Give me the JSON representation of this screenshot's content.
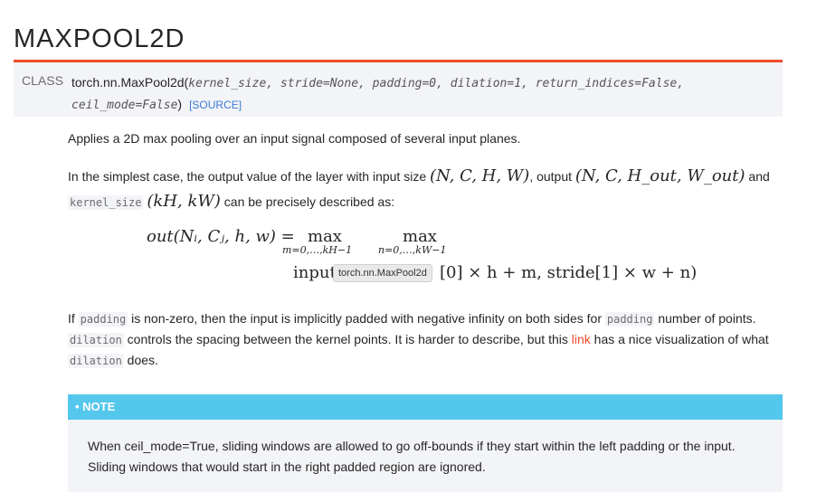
{
  "title": "MAXPOOL2D",
  "class_sig": {
    "label": "CLASS",
    "name": "torch.nn.MaxPool2d(",
    "params1": "kernel_size, stride=None, padding=0, dilation=1, return_indices=False,",
    "params2": "ceil_mode=False",
    ")": ")",
    "source": "[SOURCE]"
  },
  "desc": {
    "p1": "Applies a 2D max pooling over an input signal composed of several input planes.",
    "p2a": "In the simplest case, the output value of the layer with input size ",
    "p2m1": "(N, C, H, W)",
    "p2b": ", output ",
    "p2m2": "(N, C, H_out, W_out)",
    "p2c": " and",
    "p2code": "kernel_size",
    "p2m3": "(kH, kW)",
    "p2d": " can be precisely described as:",
    "eq_lhs": "out(Nᵢ, Cⱼ, h, w) =",
    "eq_max1": "max",
    "eq_sub1": "m=0,…,kH−1",
    "eq_max2": "max",
    "eq_sub2": "n=0,…,kW−1",
    "eq_line2a": "input",
    "eq_line2b": "[0] × h + m, stride[1] × w + n)",
    "tooltip": "torch.nn.MaxPool2d",
    "p3a": "If ",
    "p3c1": "padding",
    "p3b": " is non-zero, then the input is implicitly padded with negative infinity on both sides for ",
    "p3c2": "padding",
    "p3c": " number of points. ",
    "p3c3": "dilation",
    "p3d": " controls the spacing between the kernel points. It is harder to describe, but this ",
    "p3link": "link",
    "p3e": " has a nice visualization of what ",
    "p3c4": "dilation",
    "p3f": " does."
  },
  "note": {
    "header": "• NOTE",
    "body": "When ceil_mode=True, sliding windows are allowed to go off-bounds if they start within the left padding or the input. Sliding windows that would start in the right padded region are ignored."
  }
}
